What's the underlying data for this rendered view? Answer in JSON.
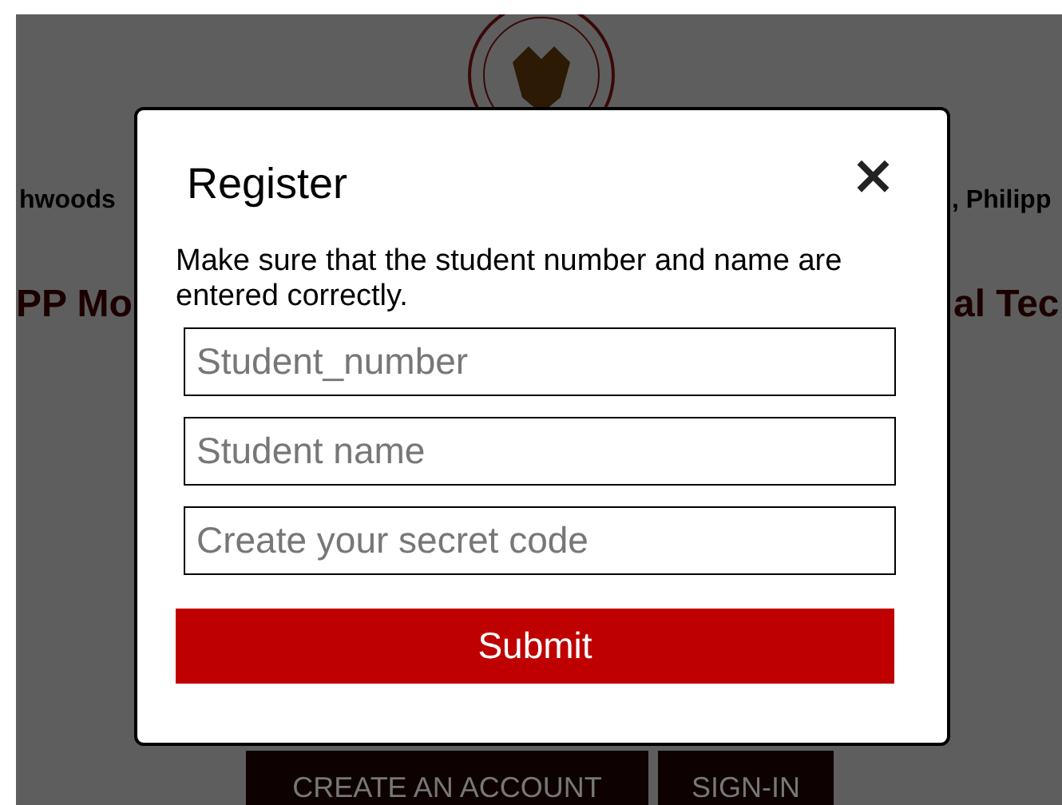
{
  "background": {
    "address_left": "hwoods",
    "address_right": ", Philipp",
    "heading_left": "PP Mo",
    "heading_right": "al Tec",
    "buttons": [
      "CREATE AN ACCOUNT",
      "SIGN-IN"
    ]
  },
  "modal": {
    "title": "Register",
    "close": "×",
    "message": "Make sure that the student number and name are entered correctly.",
    "fields": [
      {
        "placeholder": "Student_number"
      },
      {
        "placeholder": "Student name"
      },
      {
        "placeholder": "Create your secret code"
      }
    ],
    "submit": "Submit"
  }
}
